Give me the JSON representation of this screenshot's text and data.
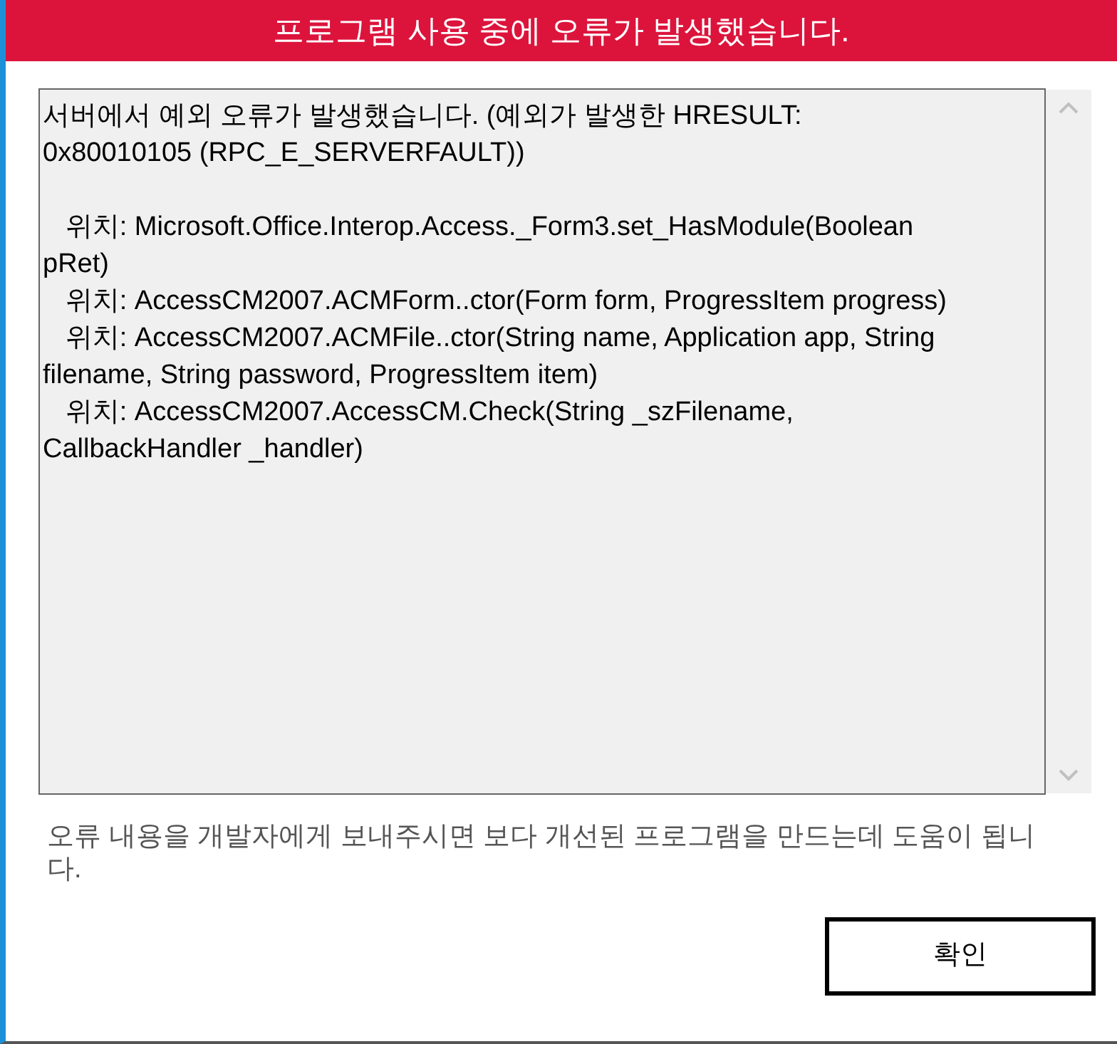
{
  "window": {
    "title": "프로그램 사용 중에 오류가 발생했습니다."
  },
  "error_details": {
    "paragraphs": [
      [
        "서버에서 예외 오류가 발생했습니다. (예외가 발생한 HRESULT:",
        "0x80010105 (RPC_E_SERVERFAULT))"
      ],
      [
        "   위치: Microsoft.Office.Interop.Access._Form3.set_HasModule(Boolean",
        "pRet)",
        "   위치: AccessCM2007.ACMForm..ctor(Form form, ProgressItem progress)",
        "   위치: AccessCM2007.ACMFile..ctor(String name, Application app, String",
        "filename, String password, ProgressItem item)",
        "   위치: AccessCM2007.AccessCM.Check(String _szFilename,",
        "CallbackHandler _handler)"
      ]
    ]
  },
  "message": "오류 내용을 개발자에게 보내주시면 보다 개선된 프로그램을 만드는데 도움이 됩니다.",
  "buttons": [
    "확인"
  ]
}
